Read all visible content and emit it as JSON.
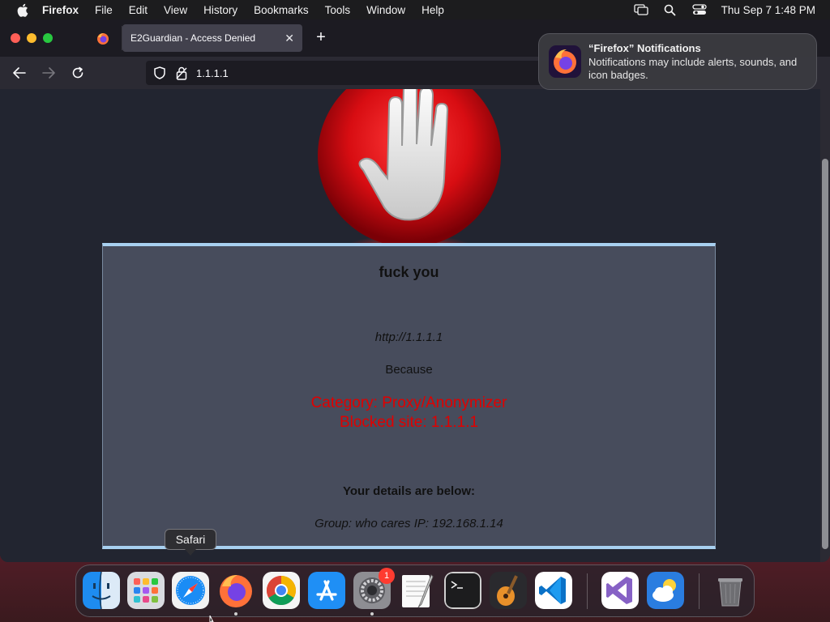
{
  "menubar": {
    "app_name": "Firefox",
    "items": [
      "File",
      "Edit",
      "View",
      "History",
      "Bookmarks",
      "Tools",
      "Window",
      "Help"
    ],
    "datetime": "Thu Sep 7  1:48 PM"
  },
  "browser": {
    "tab_title": "E2Guardian - Access Denied",
    "url": "1.1.1.1"
  },
  "notification": {
    "title": "“Firefox” Notifications",
    "body": "Notifications may include alerts, sounds, and icon badges."
  },
  "block_page": {
    "title": "fuck you",
    "url": "http://1.1.1.1",
    "because": "Because",
    "reason_line1": "Category: Proxy/Anonymizer",
    "reason_line2": "Blocked site: 1.1.1.1",
    "details_heading": "Your details are below:",
    "details": "Group: who cares   IP: 192.168.1.14"
  },
  "dock": {
    "tooltip": "Safari",
    "settings_badge": "1",
    "apps": [
      "Finder",
      "Launchpad",
      "Safari",
      "Firefox",
      "Chrome",
      "App Store",
      "System Settings",
      "TextEdit",
      "Terminal",
      "GarageBand",
      "Visual Studio Code",
      "Visual Studio",
      "Weather",
      "Trash"
    ]
  },
  "colors": {
    "reason_text": "#e00000",
    "box_border": "#a8d0f0",
    "box_bg": "#474c5c"
  }
}
